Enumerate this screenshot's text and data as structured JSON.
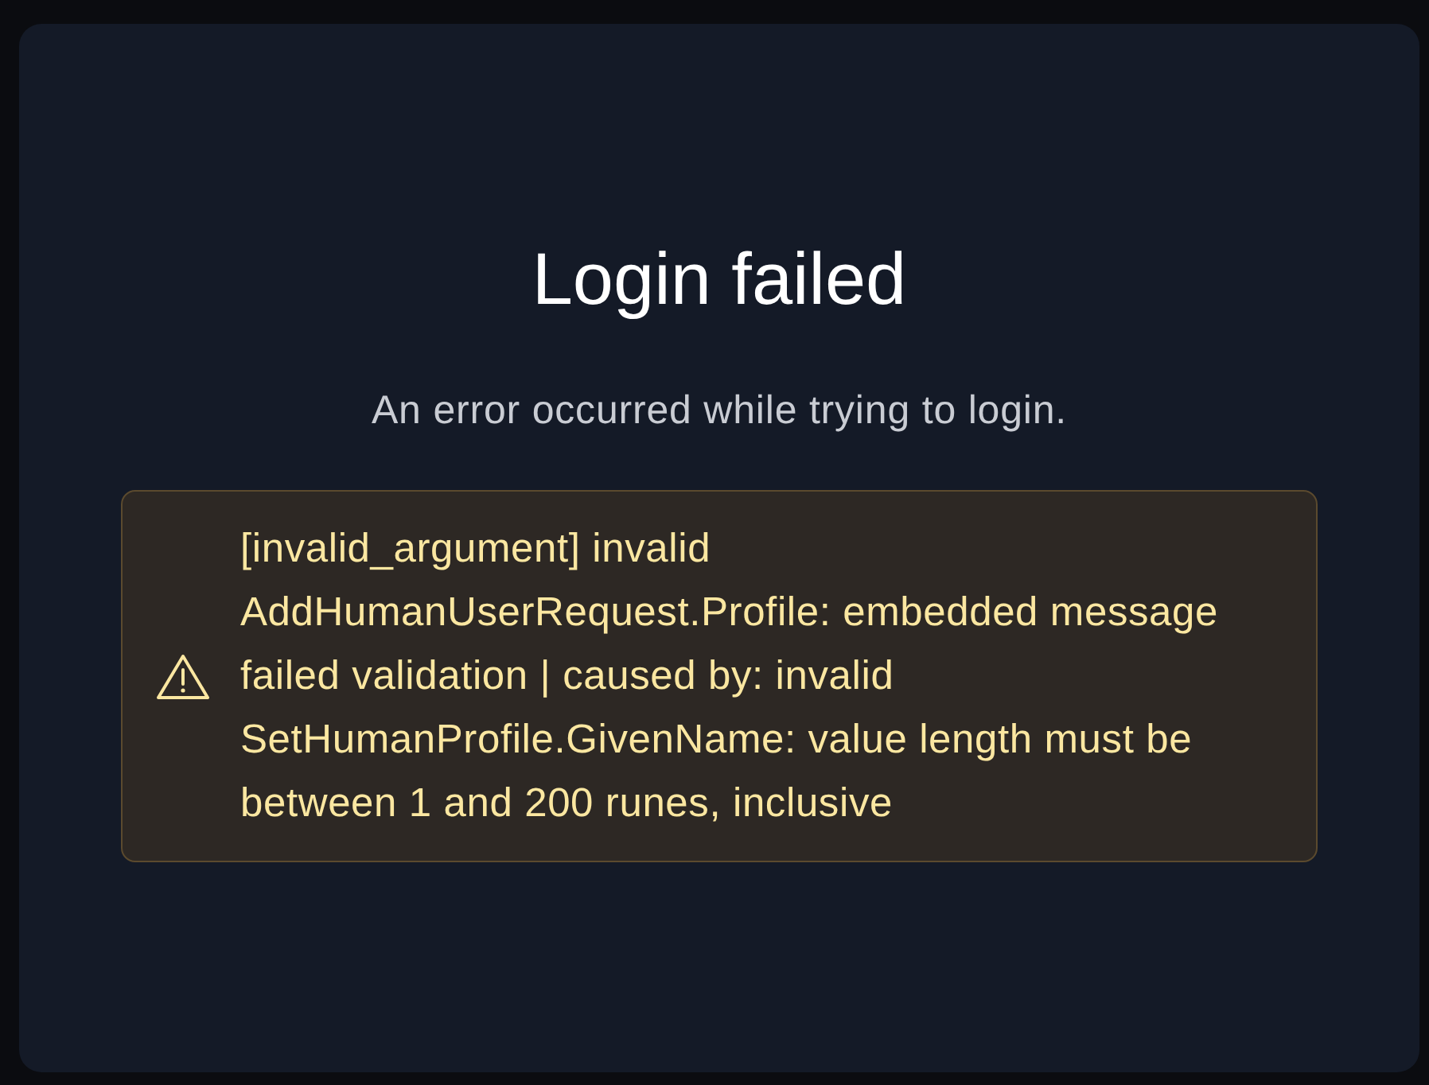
{
  "title": "Login failed",
  "subtitle": "An error occurred while trying to login.",
  "alert": {
    "kind": "warning",
    "message": "[invalid_argument] invalid AddHumanUserRequest.Profile: embedded message failed validation | caused by: invalid SetHumanProfile.GivenName: value length must be between 1 and 200 runes, inclusive"
  }
}
